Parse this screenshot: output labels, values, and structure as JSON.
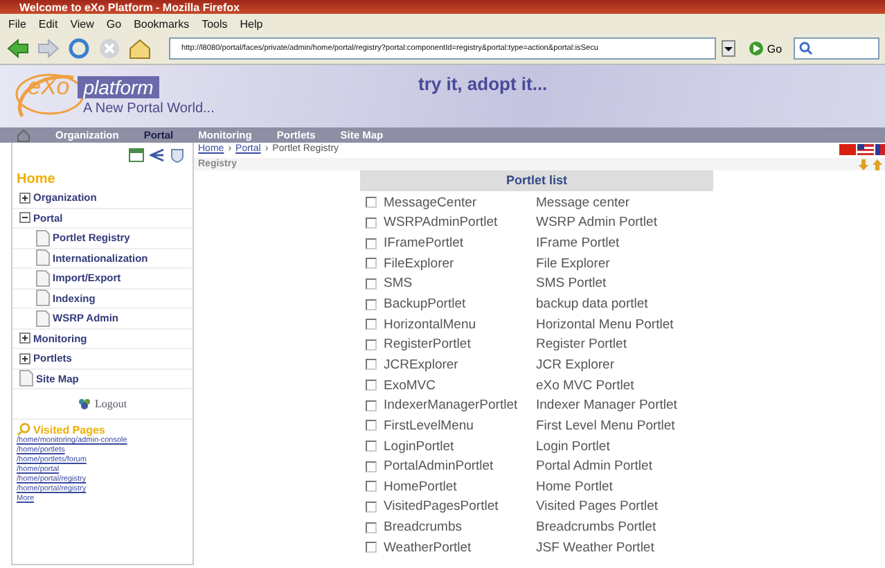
{
  "window": {
    "title": "Welcome to eXo Platform - Mozilla Firefox"
  },
  "menu": [
    "File",
    "Edit",
    "View",
    "Go",
    "Bookmarks",
    "Tools",
    "Help"
  ],
  "toolbar": {
    "address": "http://l8080/portal/faces/private/admin/home/portal/registry?portal:componentId=registry&portal:type=action&portal:isSecu",
    "go": "Go"
  },
  "banner": {
    "logo_left": "eXo",
    "logo_right": "platform",
    "tagline": "A New Portal World...",
    "slogan": "try it, adopt it..."
  },
  "nav": [
    {
      "label": "Organization",
      "selected": false
    },
    {
      "label": "Portal",
      "selected": true
    },
    {
      "label": "Monitoring",
      "selected": false
    },
    {
      "label": "Portlets",
      "selected": false
    },
    {
      "label": "Site Map",
      "selected": false
    }
  ],
  "sidebar": {
    "title": "Home",
    "items": [
      {
        "label": "Organization",
        "kind": "folder",
        "expanded": false
      },
      {
        "label": "Portal",
        "kind": "folder",
        "expanded": true,
        "children": [
          {
            "label": "Portlet Registry",
            "kind": "page"
          },
          {
            "label": "Internationalization",
            "kind": "page"
          },
          {
            "label": "Import/Export",
            "kind": "page"
          },
          {
            "label": "Indexing",
            "kind": "page"
          },
          {
            "label": "WSRP Admin",
            "kind": "page"
          }
        ]
      },
      {
        "label": "Monitoring",
        "kind": "folder",
        "expanded": false
      },
      {
        "label": "Portlets",
        "kind": "folder",
        "expanded": false
      },
      {
        "label": "Site Map",
        "kind": "page"
      }
    ],
    "logout": "Logout",
    "visited_title": "Visited Pages",
    "visited": [
      "/home/monitoring/admin-console",
      "/home/portlets",
      "/home/portlets/forum",
      "/home/portal",
      "/home/portal/registry",
      "/home/portal/registry",
      "More"
    ]
  },
  "breadcrumb": {
    "separator": "›",
    "items": [
      "Home",
      "Portal",
      "Portlet Registry"
    ]
  },
  "panel_title": "Registry",
  "portlet_list": {
    "title": "Portlet list",
    "rows": [
      {
        "name": "MessageCenter",
        "description": "Message center",
        "checked": false
      },
      {
        "name": "WSRPAdminPortlet",
        "description": "WSRP Admin Portlet",
        "checked": false
      },
      {
        "name": "IFramePortlet",
        "description": "IFrame Portlet",
        "checked": false
      },
      {
        "name": "FileExplorer",
        "description": "File Explorer",
        "checked": false
      },
      {
        "name": "SMS",
        "description": "SMS Portlet",
        "checked": false
      },
      {
        "name": "BackupPortlet",
        "description": "backup data portlet",
        "checked": false
      },
      {
        "name": "HorizontalMenu",
        "description": "Horizontal Menu Portlet",
        "checked": false
      },
      {
        "name": "RegisterPortlet",
        "description": "Register Portlet",
        "checked": false
      },
      {
        "name": "JCRExplorer",
        "description": "JCR Explorer",
        "checked": false
      },
      {
        "name": "ExoMVC",
        "description": "eXo MVC Portlet",
        "checked": false
      },
      {
        "name": "IndexerManagerPortlet",
        "description": "Indexer Manager Portlet",
        "checked": false
      },
      {
        "name": "FirstLevelMenu",
        "description": "First Level Menu Portlet",
        "checked": false
      },
      {
        "name": "LoginPortlet",
        "description": "Login Portlet",
        "checked": false
      },
      {
        "name": "PortalAdminPortlet",
        "description": "Portal Admin Portlet",
        "checked": false
      },
      {
        "name": "HomePortlet",
        "description": "Home Portlet",
        "checked": false
      },
      {
        "name": "VisitedPagesPortlet",
        "description": "Visited Pages Portlet",
        "checked": false
      },
      {
        "name": "Breadcrumbs",
        "description": "Breadcrumbs Portlet",
        "checked": false
      },
      {
        "name": "WeatherPortlet",
        "description": "JSF Weather Portlet",
        "checked": false
      }
    ]
  }
}
